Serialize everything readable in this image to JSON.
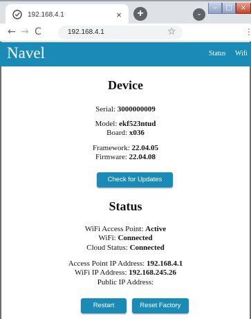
{
  "browser": {
    "tab_title": "192.168.4.1",
    "tab_close": "×",
    "new_tab": "+",
    "tab_search": "⌄",
    "window_min": "‒",
    "window_max": "□",
    "window_close": "×",
    "nav_back": "←",
    "nav_forward": "→",
    "nav_reload": "C",
    "url": "192.168.4.1",
    "bookmark_star": "☆",
    "menu": "⋮"
  },
  "site": {
    "brand": "Navel",
    "nav": {
      "status": "Status",
      "wifi": "Wifi"
    },
    "accent_color": "#1a8bb6"
  },
  "device": {
    "heading": "Device",
    "serial_label": "Serial: ",
    "serial_value": "3000000009",
    "model_label": "Model: ",
    "model_value": "ekf523ntud",
    "board_label": "Board: ",
    "board_value": "x036",
    "framework_label": "Framework: ",
    "framework_value": "22.04.05",
    "firmware_label": "Firmware: ",
    "firmware_value": "22.04.08",
    "update_button": "Check for Updates"
  },
  "status": {
    "heading": "Status",
    "ap_label": "WiFi Access Point: ",
    "ap_value": "Active",
    "wifi_label": "WiFi: ",
    "wifi_value": "Connected",
    "cloud_label": "Cloud Status: ",
    "cloud_value": "Connected",
    "ap_ip_label": "Access Point IP Address: ",
    "ap_ip_value": "192.168.4.1",
    "wifi_ip_label": "WiFi IP Address: ",
    "wifi_ip_value": "192.168.245.26",
    "public_ip_label": "Public IP Address:",
    "restart_button": "Restart",
    "reset_button": "Reset Factory"
  }
}
